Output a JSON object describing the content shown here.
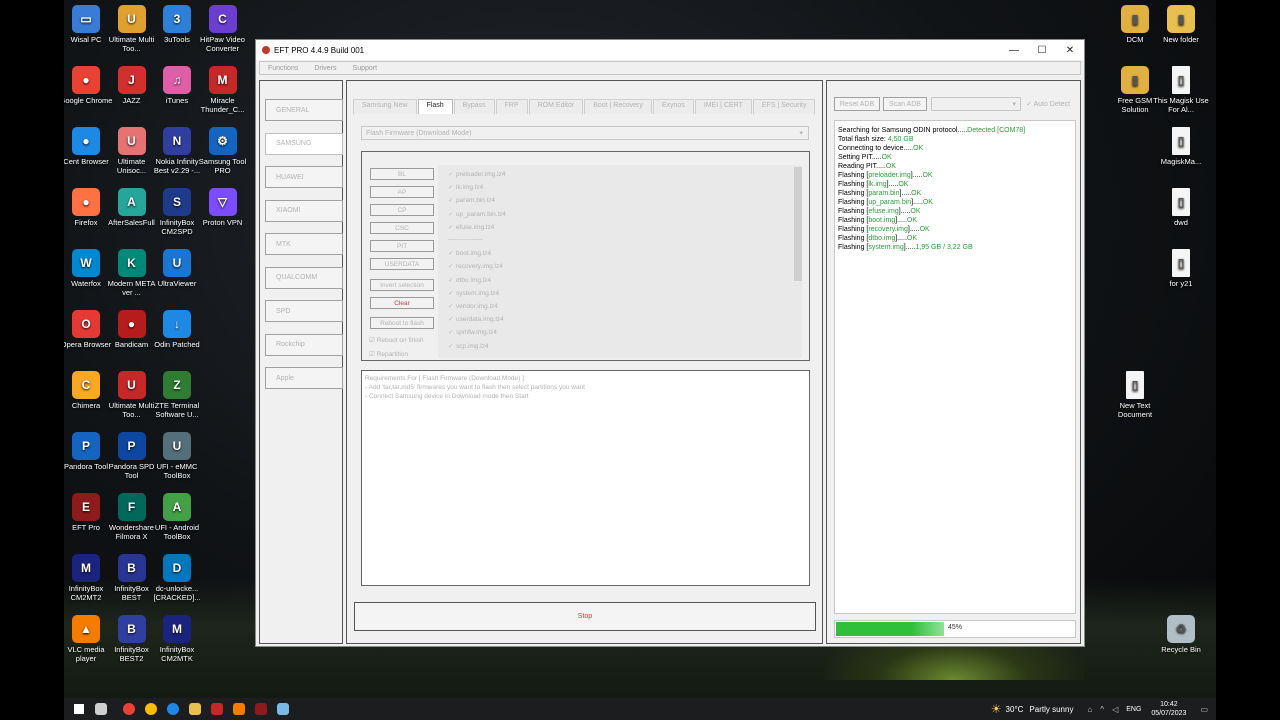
{
  "desktop": {
    "left_icons": [
      {
        "label": "Wisal PC",
        "color": "#3a7bd5",
        "glyph": "▭",
        "x": 0,
        "y": 0
      },
      {
        "label": "Ultimate Multi Too...",
        "color": "#e0a030",
        "glyph": "U",
        "x": 1,
        "y": 0
      },
      {
        "label": "3uTools",
        "color": "#2e7fd8",
        "glyph": "3",
        "x": 2,
        "y": 0
      },
      {
        "label": "HitPaw Video Converter",
        "color": "#6a3fd0",
        "glyph": "C",
        "x": 3,
        "y": 0
      },
      {
        "label": "Google Chrome",
        "color": "#e94235",
        "glyph": "●",
        "x": 0,
        "y": 1
      },
      {
        "label": "JAZZ",
        "color": "#d32f2f",
        "glyph": "J",
        "x": 1,
        "y": 1
      },
      {
        "label": "iTunes",
        "color": "#e05ea8",
        "glyph": "♫",
        "x": 2,
        "y": 1
      },
      {
        "label": "Miracle Thunder_C...",
        "color": "#c62828",
        "glyph": "M",
        "x": 3,
        "y": 1
      },
      {
        "label": "Cent Browser",
        "color": "#1e88e5",
        "glyph": "●",
        "x": 0,
        "y": 2
      },
      {
        "label": "Ultimate Unisoc...",
        "color": "#e57373",
        "glyph": "U",
        "x": 1,
        "y": 2
      },
      {
        "label": "Nokia Infinity Best v2.29 -...",
        "color": "#303f9f",
        "glyph": "N",
        "x": 2,
        "y": 2
      },
      {
        "label": "Samsung Tool PRO",
        "color": "#1565c0",
        "glyph": "⚙",
        "x": 3,
        "y": 2
      },
      {
        "label": "Firefox",
        "color": "#ff7043",
        "glyph": "●",
        "x": 0,
        "y": 3
      },
      {
        "label": "AfterSalesFull",
        "color": "#26a69a",
        "glyph": "A",
        "x": 1,
        "y": 3
      },
      {
        "label": "InfinityBox CM2SPD",
        "color": "#1e3a8a",
        "glyph": "S",
        "x": 2,
        "y": 3
      },
      {
        "label": "Proton VPN",
        "color": "#7c4dff",
        "glyph": "▽",
        "x": 3,
        "y": 3
      },
      {
        "label": "Waterfox",
        "color": "#0288d1",
        "glyph": "W",
        "x": 0,
        "y": 4
      },
      {
        "label": "Modern META ver ...",
        "color": "#00897b",
        "glyph": "K",
        "x": 1,
        "y": 4
      },
      {
        "label": "UltraViewer",
        "color": "#1976d2",
        "glyph": "U",
        "x": 2,
        "y": 4
      },
      {
        "label": "Opera Browser",
        "color": "#e53935",
        "glyph": "O",
        "x": 0,
        "y": 5
      },
      {
        "label": "Bandicam",
        "color": "#b71c1c",
        "glyph": "●",
        "x": 1,
        "y": 5
      },
      {
        "label": "Odin Patched",
        "color": "#1e88e5",
        "glyph": "↓",
        "x": 2,
        "y": 5
      },
      {
        "label": "Chimera",
        "color": "#f9a825",
        "glyph": "C",
        "x": 0,
        "y": 6
      },
      {
        "label": "Ultimate Multi Too...",
        "color": "#c62828",
        "glyph": "U",
        "x": 1,
        "y": 6
      },
      {
        "label": "ZTE Terminal Software U...",
        "color": "#2e7d32",
        "glyph": "Z",
        "x": 2,
        "y": 6
      },
      {
        "label": "Pandora Tool",
        "color": "#1565c0",
        "glyph": "P",
        "x": 0,
        "y": 7
      },
      {
        "label": "Pandora SPD Tool",
        "color": "#0d47a1",
        "glyph": "P",
        "x": 1,
        "y": 7
      },
      {
        "label": "UFI - eMMC ToolBox",
        "color": "#546e7a",
        "glyph": "U",
        "x": 2,
        "y": 7
      },
      {
        "label": "EFT Pro",
        "color": "#8e1b1b",
        "glyph": "E",
        "x": 0,
        "y": 8
      },
      {
        "label": "Wondershare Filmora X",
        "color": "#00695c",
        "glyph": "F",
        "x": 1,
        "y": 8
      },
      {
        "label": "UFI - Android ToolBox",
        "color": "#43a047",
        "glyph": "A",
        "x": 2,
        "y": 8
      },
      {
        "label": "InfinityBox CM2MT2",
        "color": "#1a237e",
        "glyph": "M",
        "x": 0,
        "y": 9
      },
      {
        "label": "InfinityBox BEST",
        "color": "#283593",
        "glyph": "B",
        "x": 1,
        "y": 9
      },
      {
        "label": "dc-unlocke... [CRACKED]...",
        "color": "#0277bd",
        "glyph": "D",
        "x": 2,
        "y": 9
      },
      {
        "label": "VLC media player",
        "color": "#f57c00",
        "glyph": "▲",
        "x": 0,
        "y": 10
      },
      {
        "label": "InfinityBox BEST2",
        "color": "#303f9f",
        "glyph": "B",
        "x": 1,
        "y": 10
      },
      {
        "label": "InfinityBox CM2MTK",
        "color": "#1a237e",
        "glyph": "M",
        "x": 2,
        "y": 10
      }
    ],
    "right_icons": [
      {
        "label": "DCM",
        "color": "#e0b040",
        "glyph": "▮",
        "x": 0,
        "y": 0
      },
      {
        "label": "New folder",
        "color": "#e8c050",
        "glyph": "▮",
        "x": 1,
        "y": 0
      },
      {
        "label": "Free GSM Solution",
        "color": "#e0b040",
        "glyph": "▮",
        "x": 0,
        "y": 1
      },
      {
        "label": "This Magisk Use For Al...",
        "color": "#f5f5f5",
        "glyph": "▯",
        "x": 1,
        "y": 1
      },
      {
        "label": "MagiskMa...",
        "color": "#f5f5f5",
        "glyph": "▯",
        "x": 1,
        "y": 2
      },
      {
        "label": "dwd",
        "color": "#f5f5f5",
        "glyph": "▯",
        "x": 1,
        "y": 3
      },
      {
        "label": "for y21",
        "color": "#f5f5f5",
        "glyph": "▯",
        "x": 1,
        "y": 4
      },
      {
        "label": "New Text Document",
        "color": "#f5f5f5",
        "glyph": "▯",
        "x": 0,
        "y": 6
      },
      {
        "label": "Recycle Bin",
        "color": "#b0bec5",
        "glyph": "♻",
        "x": 1,
        "y": 10
      }
    ]
  },
  "window": {
    "title": "EFT PRO 4.4.9 Build 001",
    "menu": [
      "Functions",
      "Drivers",
      "Support"
    ],
    "brands": [
      "GENERAL",
      "SAMSUNG",
      "HUAWEI",
      "XIAOMI",
      "MTK",
      "QUALCOMM",
      "SPD",
      "Rockchip",
      "Apple"
    ],
    "active_brand": 1,
    "tabs": [
      "Samsung New",
      "Flash",
      "Bypass",
      "FRP",
      "ROM Editor",
      "Boot | Recovery",
      "Exynos",
      "IMEI | CERT",
      "EFS | Security"
    ],
    "active_tab": 1,
    "mode_combo": "Flash Firmware (Download Mode)",
    "partition_buttons": [
      "BL",
      "AP",
      "CP",
      "CSC",
      "PIT",
      "USERDATA"
    ],
    "invert_label": "Invert selection",
    "clear_label": "Clear",
    "reboot_flash_label": "Reboot to flash",
    "reboot_finish_label": "Reboot on finish",
    "repartition_label": "Repartition",
    "files_top": [
      "preloader.img.lz4",
      "lk.img.lz4",
      "param.bin.lz4",
      "up_param.bin.lz4",
      "efuse.img.lz4"
    ],
    "files_separator": "----------------",
    "files_bottom": [
      "boot.img.lz4",
      "recovery.img.lz4",
      "dtbo.img.lz4",
      "system.img.lz4",
      "vendor.img.lz4",
      "userdata.img.lz4",
      "spmfw.img.lz4",
      "scp.img.lz4"
    ],
    "requirements": [
      "Requirements For [ Flash Firmware (Download Mode) ]:",
      "- Add 'tar,tar.md5' firmwares you want to flash then select partitions you want",
      "- Connect Samsung device in Download mode then Start"
    ],
    "stop_label": "Stop",
    "reset_adb": "Reset ADB",
    "scan_adb": "Scan ADB",
    "auto_detect": "Auto Detect",
    "log": [
      {
        "t": "Searching for Samsung ODIN protocol.....",
        "g": "Detected [COM78]"
      },
      {
        "t": "Total flash size: ",
        "g": "4,50 GB"
      },
      {
        "t": "Connecting to device.....",
        "g": "OK"
      },
      {
        "t": "Setting PIT.....",
        "g": "OK"
      },
      {
        "t": "Reading PIT.....",
        "g": "OK"
      },
      {
        "t": "Flashing [",
        "p": "preloader.img",
        "s": "].....",
        "g": "OK"
      },
      {
        "t": "Flashing [",
        "p": "lk.img",
        "s": "].....",
        "g": "OK"
      },
      {
        "t": "Flashing [",
        "p": "param.bin",
        "s": "].....",
        "g": "OK"
      },
      {
        "t": "Flashing [",
        "p": "up_param.bin",
        "s": "].....",
        "g": "OK"
      },
      {
        "t": "Flashing [",
        "p": "efuse.img",
        "s": "].....",
        "g": "OK"
      },
      {
        "t": "Flashing [",
        "p": "boot.img",
        "s": "].....",
        "g": "OK"
      },
      {
        "t": "Flashing [",
        "p": "recovery.img",
        "s": "].....",
        "g": "OK"
      },
      {
        "t": "Flashing [",
        "p": "dtbo.img",
        "s": "].....",
        "g": "OK"
      },
      {
        "t": "Flashing [",
        "p": "system.img",
        "s": "].....",
        "g": "1,95 GB / 3,22 GB"
      }
    ],
    "progress_percent": 45,
    "progress_label": "45%",
    "progress_color": "#2fbf3a"
  },
  "taskbar": {
    "weather_temp": "30°C",
    "weather_desc": "Partly sunny",
    "lang": "ENG",
    "time": "10:42",
    "date": "05/07/2023",
    "apps": [
      {
        "name": "start-icon",
        "color": "#ffffff"
      },
      {
        "name": "task-view-icon",
        "color": "#cfcfcf"
      },
      {
        "name": "chrome-icon",
        "color": "#e94235"
      },
      {
        "name": "chrome-icon",
        "color": "#fbbc05"
      },
      {
        "name": "cent-browser-icon",
        "color": "#1e88e5"
      },
      {
        "name": "file-explorer-icon",
        "color": "#e8c050"
      },
      {
        "name": "bandicam-icon",
        "color": "#c62828"
      },
      {
        "name": "vlc-icon",
        "color": "#f57c00"
      },
      {
        "name": "eft-pro-icon",
        "color": "#8e1b1b"
      },
      {
        "name": "notepad-icon",
        "color": "#7ab8e8"
      }
    ]
  }
}
